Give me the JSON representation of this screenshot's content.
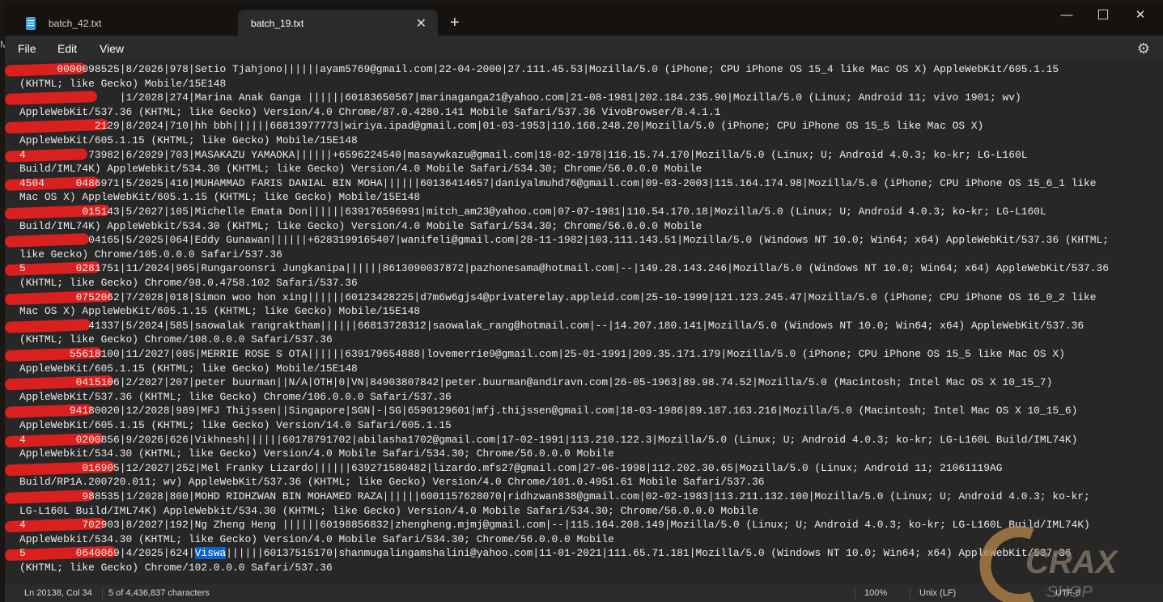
{
  "tabs": [
    {
      "label": "batch_42.txt",
      "active": false
    },
    {
      "label": "batch_19.txt",
      "active": true
    }
  ],
  "new_tab": "+",
  "tab_close": "✕",
  "window_controls": {
    "minimize": "—",
    "maximize": "☐",
    "close": "✕"
  },
  "menu": {
    "file": "File",
    "edit": "Edit",
    "view": "View"
  },
  "settings_icon": "⚙",
  "editor": {
    "rows": [
      {
        "text": "      0000098525|8/2026|978|Setio Tjahjono||||||ayam5769@gmail.com|22-04-2000|27.111.45.53|Mozilla/5.0 (iPhone; CPU iPhone OS 15_4 like Mac OS X) AppleWebKit/605.1.15",
        "redacted": true
      },
      {
        "text": "(KHTML; like Gecko) Mobile/15E148"
      },
      {
        "text": "                |1/2028|274|Marina Anak Ganga ||||||60183650567|marinaganga21@yahoo.com|21-08-1981|202.184.235.90|Mozilla/5.0 (Linux; Android 11; vivo 1901; wv)",
        "redacted": true
      },
      {
        "text": "AppleWebKit/537.36 (KHTML; like Gecko) Version/4.0 Chrome/87.0.4280.141 Mobile Safari/537.36 VivoBrowser/8.4.1.1"
      },
      {
        "text": "            2129|8/2024|710|hh bbh||||||66813977773|wiriya.ipad@gmail.com|01-03-1953|110.168.248.20|Mozilla/5.0 (iPhone; CPU iPhone OS 15_5 like Mac OS X)",
        "redacted": true
      },
      {
        "text": "AppleWebKit/605.1.15 (KHTML; like Gecko) Mobile/15E148"
      },
      {
        "text": "4          73982|6/2029|703|MASAKAZU YAMAOKA||||||+6596224540|masaywkazu@gmail.com|18-02-1978|116.15.74.170|Mozilla/5.0 (Linux; U; Android 4.0.3; ko-kr; LG-L160L",
        "redacted": true
      },
      {
        "text": "Build/IML74K) AppleWebkit/534.30 (KHTML; like Gecko) Version/4.0 Mobile Safari/534.30; Chrome/56.0.0.0 Mobile"
      },
      {
        "text": "4504     0486971|5/2025|416|MUHAMMAD FARIS DANIAL BIN MOHA||||||60136414657|daniyalmuhd76@gmail.com|09-03-2003|115.164.174.98|Mozilla/5.0 (iPhone; CPU iPhone OS 15_6_1 like",
        "redacted": true
      },
      {
        "text": "Mac OS X) AppleWebKit/605.1.15 (KHTML; like Gecko) Mobile/15E148"
      },
      {
        "text": "          015143|5/2027|105|Michelle Emata Don||||||639176596991|mitch_am23@yahoo.com|07-07-1981|110.54.170.18|Mozilla/5.0 (Linux; U; Android 4.0.3; ko-kr; LG-L160L",
        "redacted": true
      },
      {
        "text": "Build/IML74K) AppleWebkit/534.30 (KHTML; like Gecko) Version/4.0 Mobile Safari/534.30; Chrome/56.0.0.0 Mobile"
      },
      {
        "text": "           04165|5/2025|064|Eddy Gunawan||||||+6283199165407|wanifeli@gmail.com|28-11-1982|103.111.143.51|Mozilla/5.0 (Windows NT 10.0; Win64; x64) AppleWebKit/537.36 (KHTML;",
        "redacted": true
      },
      {
        "text": "like Gecko) Chrome/105.0.0.0 Safari/537.36"
      },
      {
        "text": "5        0281751|11/2024|965|Rungaroonsri Jungkanipa||||||8613090037872|pazhonesama@hotmail.com|--|149.28.143.246|Mozilla/5.0 (Windows NT 10.0; Win64; x64) AppleWebKit/537.36",
        "redacted": true
      },
      {
        "text": "(KHTML; like Gecko) Chrome/98.0.4758.102 Safari/537.36"
      },
      {
        "text": "         0752062|7/2028|018|Simon woo hon xing||||||60123428225|d7m6w6gjs4@privaterelay.appleid.com|25-10-1999|121.123.245.47|Mozilla/5.0 (iPhone; CPU iPhone OS 16_0_2 like",
        "redacted": true
      },
      {
        "text": "Mac OS X) AppleWebKit/605.1.15 (KHTML; like Gecko) Mobile/15E148"
      },
      {
        "text": "           41337|5/2024|585|saowalak rangraktham||||||66813728312|saowalak_rang@hotmail.com|--|14.207.180.141|Mozilla/5.0 (Windows NT 10.0; Win64; x64) AppleWebKit/537.36",
        "redacted": true
      },
      {
        "text": "(KHTML; like Gecko) Chrome/108.0.0.0 Safari/537.36"
      },
      {
        "text": "        55618100|11/2027|085|MERRIE ROSE S OTA||||||639179654888|lovemerrie9@gmail.com|25-01-1991|209.35.171.179|Mozilla/5.0 (iPhone; CPU iPhone OS 15_5 like Mac OS X)",
        "redacted": true
      },
      {
        "text": "AppleWebKit/605.1.15 (KHTML; like Gecko) Mobile/15E148"
      },
      {
        "text": "         0415106|2/2027|207|peter buurman||N/A|OTH|0|VN|84903807842|peter.buurman@andiravn.com|26-05-1963|89.98.74.52|Mozilla/5.0 (Macintosh; Intel Mac OS X 10_15_7)",
        "redacted": true
      },
      {
        "text": "AppleWebKit/537.36 (KHTML; like Gecko) Chrome/106.0.0.0 Safari/537.36"
      },
      {
        "text": "        94180020|12/2028|989|MFJ Thijssen||Singapore|SGN|-|SG|6590129601|mfj.thijssen@gmail.com|18-03-1986|89.187.163.216|Mozilla/5.0 (Macintosh; Intel Mac OS X 10_15_6)",
        "redacted": true
      },
      {
        "text": "AppleWebKit/605.1.15 (KHTML; like Gecko) Version/14.0 Safari/605.1.15"
      },
      {
        "text": "4        0200856|9/2026|626|Vikhnesh||||||60178791702|abilasha1702@gmail.com|17-02-1991|113.210.122.3|Mozilla/5.0 (Linux; U; Android 4.0.3; ko-kr; LG-L160L Build/IML74K)",
        "redacted": true
      },
      {
        "text": "AppleWebkit/534.30 (KHTML; like Gecko) Version/4.0 Mobile Safari/534.30; Chrome/56.0.0.0 Mobile"
      },
      {
        "text": "          016905|12/2027|252|Mel Franky Lizardo||||||639271580482|lizardo.mfs27@gmail.com|27-06-1998|112.202.30.65|Mozilla/5.0 (Linux; Android 11; 21061119AG",
        "redacted": true
      },
      {
        "text": "Build/RP1A.200720.011; wv) AppleWebKit/537.36 (KHTML; like Gecko) Version/4.0 Chrome/101.0.4951.61 Mobile Safari/537.36"
      },
      {
        "text": "          988535|1/2028|800|MOHD RIDHZWAN BIN MOHAMED RAZA||||||6001157628070|ridhzwan838@gmail.com|02-02-1983|113.211.132.100|Mozilla/5.0 (Linux; U; Android 4.0.3; ko-kr;",
        "redacted": true
      },
      {
        "text": "LG-L160L Build/IML74K) AppleWebkit/534.30 (KHTML; like Gecko) Version/4.0 Mobile Safari/534.30; Chrome/56.0.0.0 Mobile"
      },
      {
        "text": "4         702903|8/2027|192|Ng Zheng Heng ||||||60198856832|zhengheng.mjmj@gmail.com|--|115.164.208.149|Mozilla/5.0 (Linux; U; Android 4.0.3; ko-kr; LG-L160L Build/IML74K)",
        "redacted": true
      },
      {
        "text": "AppleWebkit/534.30 (KHTML; like Gecko) Version/4.0 Mobile Safari/534.30; Chrome/56.0.0.0 Mobile"
      },
      {
        "pre": "5        0640069|4/2025|624|",
        "selected": "Viswa",
        "post": "||||||60137515170|shanmugalingamshalini@yahoo.com|11-01-2021|111.65.71.181|Mozilla/5.0 (Windows NT 10.0; Win64; x64) AppleWebKit/537.36",
        "redacted": true
      },
      {
        "text": "(KHTML; like Gecko) Chrome/102.0.0.0 Safari/537.36"
      }
    ]
  },
  "status": {
    "position": "Ln 20138, Col 34",
    "selection": "5 of 4,436,837 characters",
    "zoom": "100%",
    "line_ending": "Unix (LF)",
    "encoding": "UTF-8"
  },
  "watermark": {
    "logo_text": "CRAX",
    "sub_text": "SHOP"
  },
  "colors": {
    "redaction": "#e4201f",
    "selection": "#0a64c8",
    "spellcheck": "#e0302a",
    "editor_bg": "#272727"
  }
}
